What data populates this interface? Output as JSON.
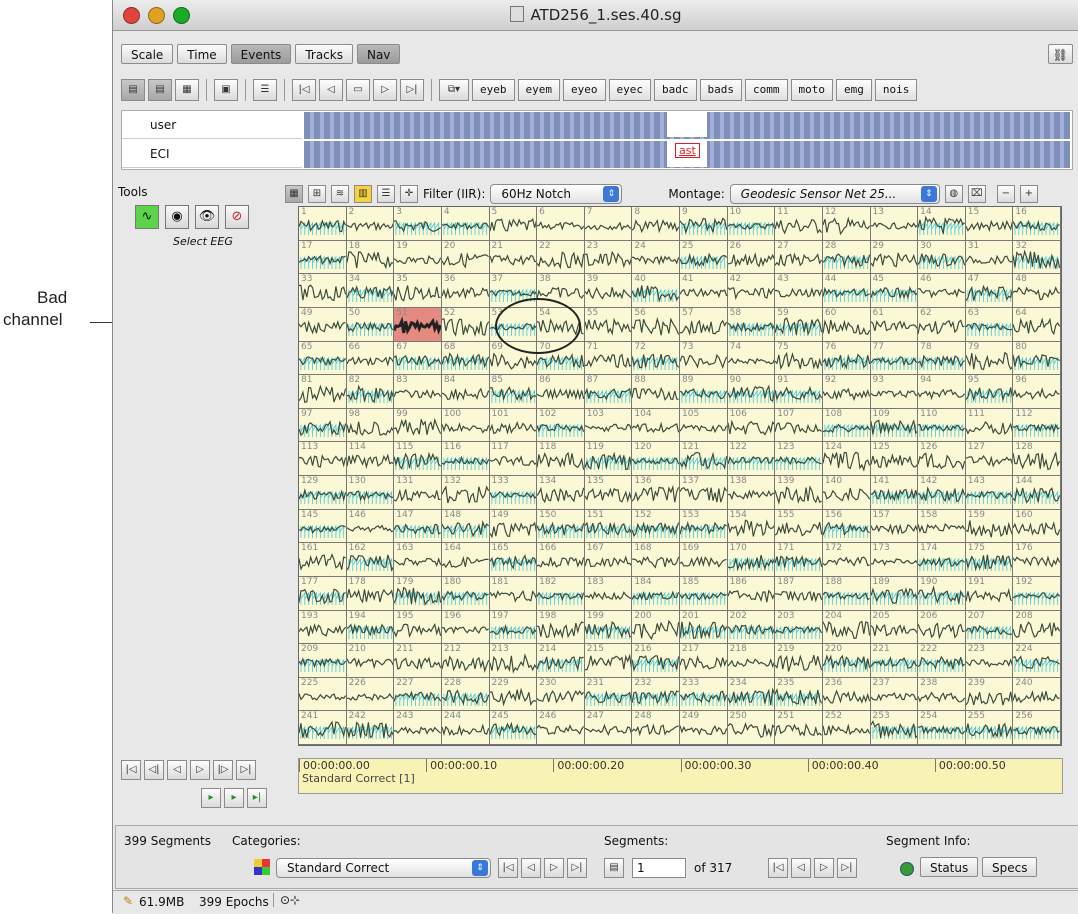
{
  "annotation": {
    "line1": "Bad",
    "line2": "channel"
  },
  "window": {
    "title": "ATD256_1.ses.40.sg"
  },
  "view_tabs": [
    "Scale",
    "Time",
    "Events",
    "Tracks",
    "Nav"
  ],
  "event_buttons": [
    "eyeb",
    "eyem",
    "eyeo",
    "eyec",
    "badc",
    "bads",
    "comm",
    "moto",
    "emg",
    "nois"
  ],
  "tracks": [
    {
      "label": "user"
    },
    {
      "label": "ECI",
      "marker": "ast"
    }
  ],
  "tools": {
    "label": "Tools",
    "caption": "Select EEG"
  },
  "filter": {
    "label": "Filter (IIR):",
    "value": "60Hz Notch"
  },
  "montage": {
    "label": "Montage:",
    "value": "Geodesic Sensor Net 25..."
  },
  "grid": {
    "channels": 256,
    "columns": 16,
    "bad_channel": 51
  },
  "timeline": {
    "ticks": [
      "00:00:00.00",
      "00:00:00.10",
      "00:00:00.20",
      "00:00:00.30",
      "00:00:00.40",
      "00:00:00.50"
    ],
    "category_label": "Standard Correct [1]"
  },
  "bottom": {
    "segments_count": "399 Segments",
    "categories_label": "Categories:",
    "category_value": "Standard Correct",
    "segments_label": "Segments:",
    "segment_value": "1",
    "segment_of": "of 317",
    "segment_info_label": "Segment Info:",
    "status_btn": "Status",
    "specs_btn": "Specs"
  },
  "statusbar": {
    "memory": "61.9MB",
    "epochs": "399 Epochs"
  }
}
